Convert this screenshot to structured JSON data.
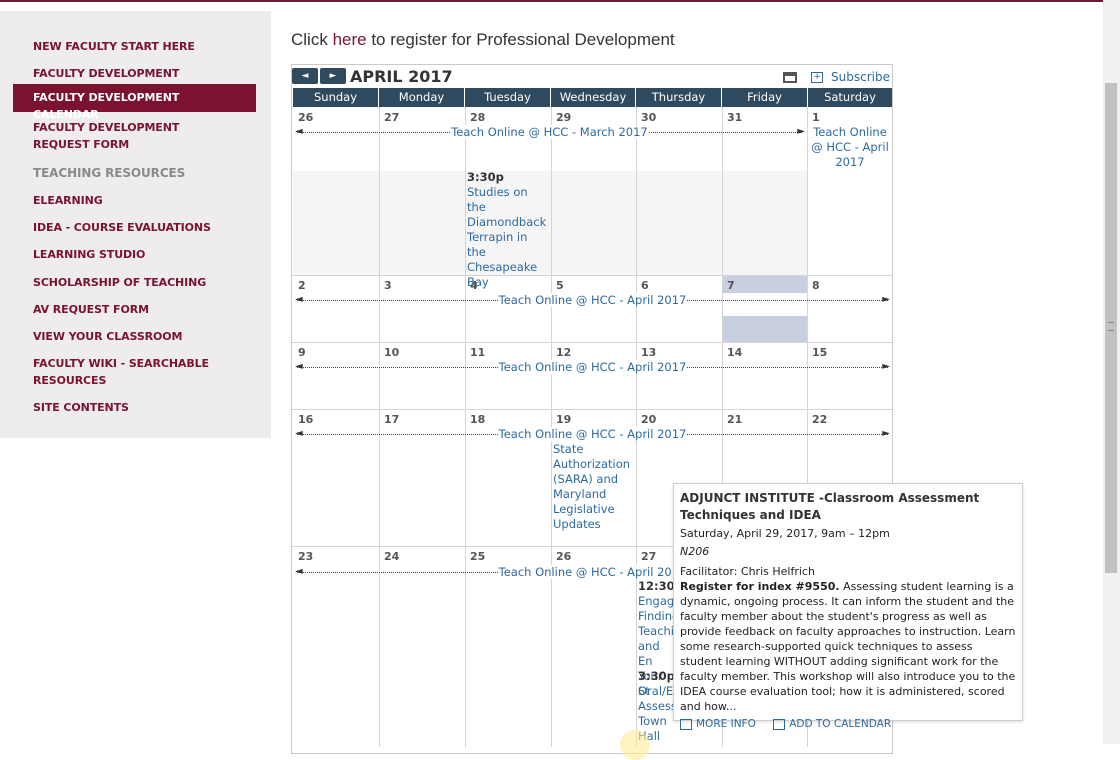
{
  "sidebar": {
    "items": [
      {
        "label": "NEW FACULTY START HERE"
      },
      {
        "label": "FACULTY DEVELOPMENT"
      },
      {
        "label": "FACULTY DEVELOPMENT CALENDAR",
        "active": true
      },
      {
        "label": "FACULTY DEVELOPMENT REQUEST FORM"
      },
      {
        "label": "TEACHING RESOURCES",
        "heading": true
      },
      {
        "label": "ELEARNING"
      },
      {
        "label": "IDEA - COURSE EVALUATIONS"
      },
      {
        "label": "LEARNING STUDIO"
      },
      {
        "label": "SCHOLARSHIP OF TEACHING"
      },
      {
        "label": "AV REQUEST FORM"
      },
      {
        "label": "VIEW YOUR CLASSROOM"
      },
      {
        "label": "FACULTY WIKI - SEARCHABLE RESOURCES"
      },
      {
        "label": "SITE CONTENTS"
      }
    ]
  },
  "register": {
    "prefix": "Click ",
    "link": "here",
    "suffix": " to register for Professional Development"
  },
  "calendar": {
    "month": "APRIL 2017",
    "prev": "◄",
    "next": "►",
    "print_icon": "print-icon",
    "subscribe": "Subscribe",
    "days": [
      "Sunday",
      "Monday",
      "Tuesday",
      "Wednesday",
      "Thursday",
      "Friday",
      "Saturday"
    ],
    "weeks": [
      [
        "26",
        "27",
        "28",
        "29",
        "30",
        "31",
        "1"
      ],
      [
        "2",
        "3",
        "4",
        "5",
        "6",
        "7",
        "8"
      ],
      [
        "9",
        "10",
        "11",
        "12",
        "13",
        "14",
        "15"
      ],
      [
        "16",
        "17",
        "18",
        "19",
        "20",
        "21",
        "22"
      ],
      [
        "23",
        "24",
        "25",
        "26",
        "27",
        "28",
        "29"
      ]
    ],
    "span_march": "Teach Online @ HCC - March 2017",
    "span_april": "Teach Online @ HCC - April 2017",
    "sat1_event": "Teach Online @ HCC - April 2017",
    "ev_terrapin_time": "3:30p",
    "ev_terrapin_title": "Studies on the Diamondback Terrapin in the Chesapeake Bay",
    "ev_sara": "State Authorization (SARA) and Maryland Legislative Updates",
    "ev_27a_time": "12:30p",
    "ev_27a_title": "Engage Finding Teachin and En Your St",
    "ev_27b_time": "3:30p",
    "ev_27b_title": "Oral/Ex Assessi Town Hall"
  },
  "popup": {
    "title": "ADJUNCT INSTITUTE -Classroom Assessment Techniques and IDEA",
    "date": "Saturday, April 29, 2017, 9am – 12pm",
    "location": "N206",
    "facilitator": "Facilitator: Chris Helfrich",
    "register_bold": "Register for index #9550.",
    "body": "  Assessing student learning is a dynamic, ongoing process. It can inform the student and the faculty member about the student's progress as well as provide feedback on faculty approaches to instruction. Learn some research-supported quick techniques to assess student learning WITHOUT adding significant work for the faculty member. This workshop will also introduce you to the IDEA course evaluation tool; how it is administered, scored and how...",
    "more_info": "MORE INFO",
    "add_to_calendar": "ADD TO CALENDAR"
  },
  "colors": {
    "brand": "#7a1230",
    "header": "#2f4a5f",
    "link": "#2d6aa1",
    "today": "#c7cfe0"
  }
}
